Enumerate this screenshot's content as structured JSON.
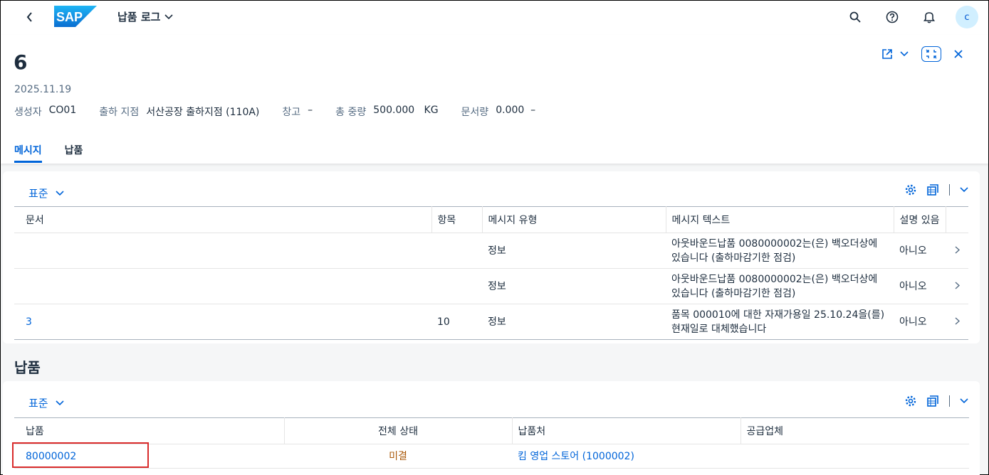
{
  "shell": {
    "app_title": "납품 로그",
    "avatar_initial": "c",
    "logo_text": "SAP"
  },
  "header": {
    "title": "6",
    "date": "2025.11.19",
    "attributes": [
      {
        "label": "생성자",
        "value": "CO01"
      },
      {
        "label": "출하 지점",
        "value": "서산공장 출하지점 (110A)"
      },
      {
        "label": "창고",
        "value": "–"
      },
      {
        "label": "총 중량",
        "value": "500.000   KG"
      },
      {
        "label": "문서량",
        "value": "0.000  –"
      }
    ],
    "tabs": [
      {
        "label": "메시지",
        "active": true
      },
      {
        "label": "납품",
        "active": false
      }
    ]
  },
  "messages": {
    "variant": "표준",
    "columns": [
      "문서",
      "항목",
      "메시지 유형",
      "메시지 텍스트",
      "설명 있음"
    ],
    "rows": [
      {
        "doc": "",
        "item": "",
        "type": "정보",
        "text": "아웃바운드납품 0080000002는(은) 백오더상에 있습니다 (출하마감기한 점검)",
        "desc": "아니오"
      },
      {
        "doc": "",
        "item": "",
        "type": "정보",
        "text": "아웃바운드납품 0080000002는(은) 백오더상에 있습니다 (출하마감기한 점검)",
        "desc": "아니오"
      },
      {
        "doc": "3",
        "item": "10",
        "type": "정보",
        "text": "품목 000010에 대한 자재가용일 25.10.24을(를) 현재일로 대체했습니다",
        "desc": "아니오"
      }
    ]
  },
  "deliveries": {
    "section_title": "납품",
    "variant": "표준",
    "columns": [
      "납품",
      "전체 상태",
      "납품처",
      "공급업체"
    ],
    "rows": [
      {
        "delivery": "80000002",
        "status": "미결",
        "ship_to": "킴 영업 스토어 (1000002)",
        "supplier": ""
      }
    ]
  },
  "colors": {
    "accent": "#0064d9",
    "status_warning": "#aa5808",
    "highlight": "#d92b2b"
  }
}
